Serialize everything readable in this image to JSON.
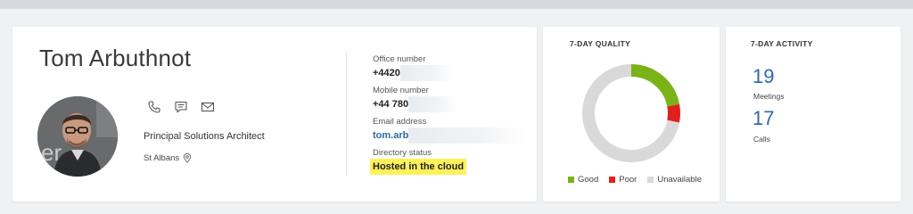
{
  "profile": {
    "name": "Tom Arbuthnot",
    "job_title": "Principal Solutions Architect",
    "location": "St Albans",
    "avatar_text": "er",
    "actions": [
      {
        "icon": "phone-icon"
      },
      {
        "icon": "chat-icon"
      },
      {
        "icon": "mail-icon"
      }
    ],
    "fields": {
      "office": {
        "label": "Office number",
        "value": "+4420"
      },
      "mobile": {
        "label": "Mobile number",
        "value": "+44 780"
      },
      "email": {
        "label": "Email address",
        "value": "tom.arb"
      },
      "directory": {
        "label": "Directory status",
        "value": "Hosted in the cloud",
        "highlight_color": "#fdf15a"
      }
    }
  },
  "quality": {
    "title": "7-DAY QUALITY",
    "legend": [
      {
        "label": "Good",
        "color": "#7ab317"
      },
      {
        "label": "Poor",
        "color": "#e01f1f"
      },
      {
        "label": "Unavailable",
        "color": "#d9d9d9"
      }
    ],
    "chart_data": {
      "type": "pie",
      "title": "7-DAY QUALITY",
      "categories": [
        "Good",
        "Poor",
        "Unavailable"
      ],
      "values": [
        22,
        6,
        72
      ],
      "unit": "percent (estimated)",
      "legend_position": "bottom"
    }
  },
  "activity": {
    "title": "7-DAY ACTIVITY",
    "meetings": {
      "value": "19",
      "label": "Meetings"
    },
    "calls": {
      "value": "17",
      "label": "Calls"
    }
  },
  "colors": {
    "accent": "#2b6aa5",
    "good": "#7ab317",
    "poor": "#e01f1f",
    "unavailable": "#d9d9d9"
  }
}
